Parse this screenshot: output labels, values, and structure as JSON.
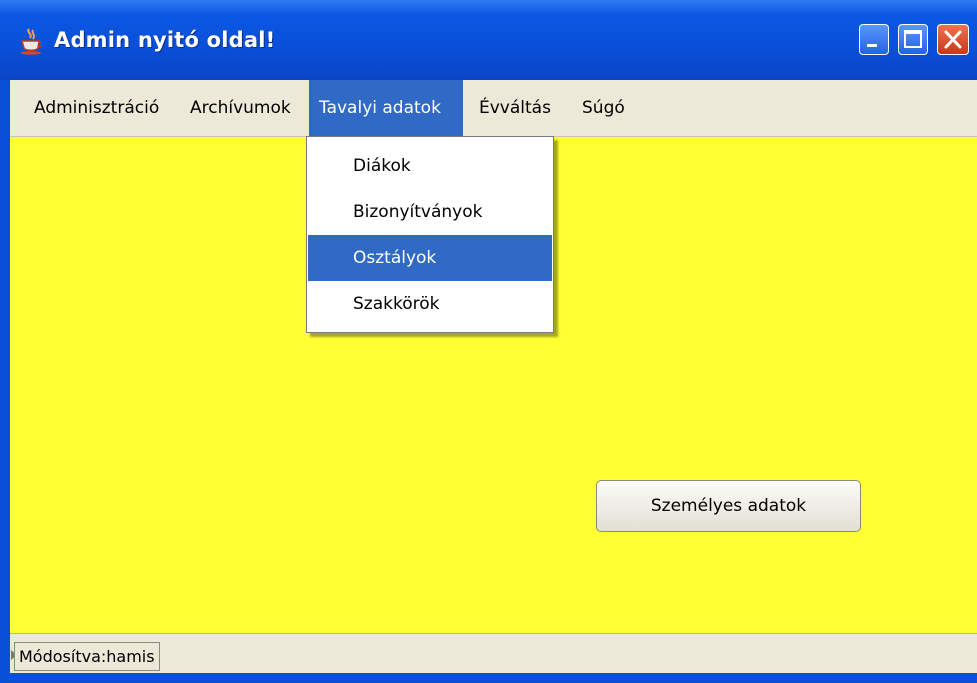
{
  "window": {
    "title": "Admin nyitó oldal!",
    "colors": {
      "titlebar": "#0a4fd8",
      "content_background": "#ffff33",
      "menu_highlight": "#316ac5",
      "close_button": "#d9482a"
    }
  },
  "menubar": {
    "items": [
      {
        "label": "Adminisztráció"
      },
      {
        "label": "Archívumok"
      },
      {
        "label": "Tavalyi adatok",
        "open": true
      },
      {
        "label": "Évváltás"
      },
      {
        "label": "Súgó"
      }
    ]
  },
  "dropdown": {
    "items": [
      {
        "label": "Diákok"
      },
      {
        "label": "Bizonyítványok"
      },
      {
        "label": "Osztályok",
        "selected": true
      },
      {
        "label": "Szakkörök"
      }
    ]
  },
  "main": {
    "button_label": "Személyes adatok"
  },
  "statusbar": {
    "text": "Módosítva:hamis"
  },
  "icons": [
    "java-cup-icon",
    "minimize-icon",
    "maximize-icon",
    "close-icon"
  ]
}
